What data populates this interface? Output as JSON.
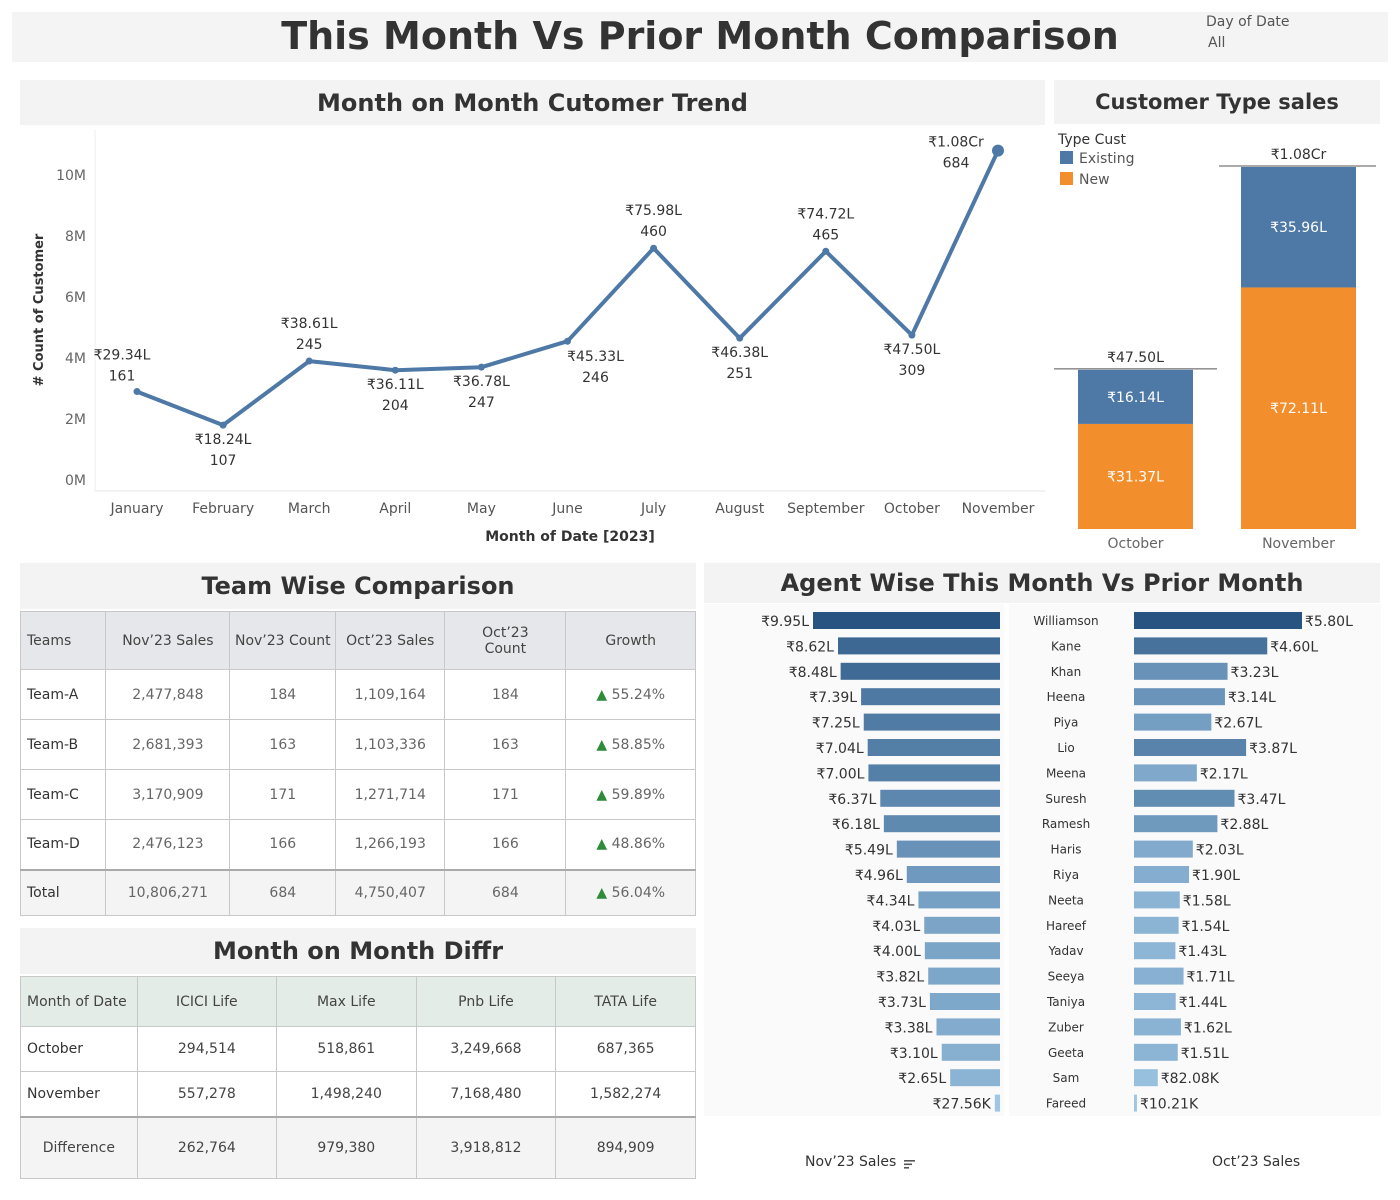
{
  "header": {
    "title": "This Month Vs Prior Month Comparison",
    "filter_label": "Day of Date",
    "filter_value": "All"
  },
  "colors": {
    "line": "#4e79a7",
    "existing": "#4e79a7",
    "new": "#f28e2b",
    "growth_up": "#2e8b3a"
  },
  "trend": {
    "title": "Month on Month Cutomer Trend"
  },
  "customer_type": {
    "title": "Customer Type sales",
    "legend_title": "Type Cust"
  },
  "team": {
    "title": "Team Wise  Comparison",
    "headers": [
      "Teams",
      "Nov’23  Sales",
      "Nov’23  Count",
      "Oct’23 Sales",
      "Oct’23 Count",
      "Growth"
    ],
    "rows": [
      {
        "team": "Team-A",
        "nov_sales": "2,477,848",
        "nov_count": "184",
        "oct_sales": "1,109,164",
        "oct_count": "184",
        "growth": "55.24%"
      },
      {
        "team": "Team-B",
        "nov_sales": "2,681,393",
        "nov_count": "163",
        "oct_sales": "1,103,336",
        "oct_count": "163",
        "growth": "58.85%"
      },
      {
        "team": "Team-C",
        "nov_sales": "3,170,909",
        "nov_count": "171",
        "oct_sales": "1,271,714",
        "oct_count": "171",
        "growth": "59.89%"
      },
      {
        "team": "Team-D",
        "nov_sales": "2,476,123",
        "nov_count": "166",
        "oct_sales": "1,266,193",
        "oct_count": "166",
        "growth": "48.86%"
      }
    ],
    "total": {
      "team": "Total",
      "nov_sales": "10,806,271",
      "nov_count": "684",
      "oct_sales": "4,750,407",
      "oct_count": "684",
      "growth": "56.04%"
    },
    "growth_icon": "▲"
  },
  "mom": {
    "title": "Month on Month Diffr",
    "headers": [
      "Month of Date",
      "ICICI Life",
      "Max Life",
      "Pnb Life",
      "TATA Life"
    ],
    "rows": [
      {
        "month": "October",
        "icici": "294,514",
        "max": "518,861",
        "pnb": "3,249,668",
        "tata": "687,365"
      },
      {
        "month": "November",
        "icici": "557,278",
        "max": "1,498,240",
        "pnb": "7,168,480",
        "tata": "1,582,274"
      }
    ],
    "diff": {
      "month": "Difference",
      "icici": "262,764",
      "max": "979,380",
      "pnb": "3,918,812",
      "tata": "894,909"
    }
  },
  "agent": {
    "title": "Agent Wise This Month Vs Prior Month",
    "nov_footer": "Nov’23 Sales",
    "oct_footer": "Oct’23 Sales"
  },
  "chart_data": [
    {
      "type": "line",
      "title": "Month on Month Cutomer Trend",
      "xlabel": "Month of Date [2023]",
      "ylabel": "# Count of Customer",
      "categories": [
        "January",
        "February",
        "March",
        "April",
        "May",
        "June",
        "July",
        "August",
        "September",
        "October",
        "November"
      ],
      "values": [
        2900000,
        1800000,
        3900000,
        3600000,
        3700000,
        4550000,
        7600000,
        4650000,
        7500000,
        4750000,
        10800000
      ],
      "sales_labels": [
        "₹29.34L",
        "₹18.24L",
        "₹38.61L",
        "₹36.11L",
        "₹36.78L",
        "₹45.33L",
        "₹75.98L",
        "₹46.38L",
        "₹74.72L",
        "₹47.50L",
        "₹1.08Cr"
      ],
      "count_labels": [
        "161",
        "107",
        "245",
        "204",
        "247",
        "246",
        "460",
        "251",
        "465",
        "309",
        "684"
      ],
      "yticks": [
        "0M",
        "2M",
        "4M",
        "6M",
        "8M",
        "10M"
      ],
      "ylim": [
        0,
        11000000
      ],
      "grid": false
    },
    {
      "type": "bar",
      "stacked": true,
      "title": "Customer Type sales",
      "legend_title": "Type Cust",
      "legend_placement": "top-left",
      "categories": [
        "October",
        "November"
      ],
      "series": [
        {
          "name": "Existing",
          "values": [
            16.14,
            35.96
          ],
          "labels": [
            "₹16.14L",
            "₹35.96L"
          ]
        },
        {
          "name": "New",
          "values": [
            31.37,
            72.11
          ],
          "labels": [
            "₹31.37L",
            "₹72.11L"
          ]
        }
      ],
      "totals": [
        "₹47.50L",
        "₹1.08Cr"
      ],
      "unit": "lakh"
    },
    {
      "type": "bar",
      "orientation": "horizontal",
      "title": "Agent Wise This Month Vs Prior Month",
      "agents": [
        "Williamson",
        "Kane",
        "Khan",
        "Heena",
        "Piya",
        "Lio",
        "Meena",
        "Suresh",
        "Ramesh",
        "Haris",
        "Riya",
        "Neeta",
        "Hareef",
        "Yadav",
        "Seeya",
        "Taniya",
        "Zuber",
        "Geeta",
        "Sam",
        "Fareed"
      ],
      "series": [
        {
          "name": "Nov’23 Sales",
          "values": [
            9.95,
            8.62,
            8.48,
            7.39,
            7.25,
            7.04,
            7.0,
            6.37,
            6.18,
            5.49,
            4.96,
            4.34,
            4.03,
            4.0,
            3.82,
            3.73,
            3.38,
            3.1,
            2.65,
            0.2756
          ],
          "labels": [
            "₹9.95L",
            "₹8.62L",
            "₹8.48L",
            "₹7.39L",
            "₹7.25L",
            "₹7.04L",
            "₹7.00L",
            "₹6.37L",
            "₹6.18L",
            "₹5.49L",
            "₹4.96L",
            "₹4.34L",
            "₹4.03L",
            "₹4.00L",
            "₹3.82L",
            "₹3.73L",
            "₹3.38L",
            "₹3.10L",
            "₹2.65L",
            "₹27.56K"
          ]
        },
        {
          "name": "Oct’23 Sales",
          "values": [
            5.8,
            4.6,
            3.23,
            3.14,
            2.67,
            3.87,
            2.17,
            3.47,
            2.88,
            2.03,
            1.9,
            1.58,
            1.54,
            1.43,
            1.71,
            1.44,
            1.62,
            1.51,
            0.8208,
            0.1021
          ],
          "labels": [
            "₹5.80L",
            "₹4.60L",
            "₹3.23L",
            "₹3.14L",
            "₹2.67L",
            "₹3.87L",
            "₹2.17L",
            "₹3.47L",
            "₹2.88L",
            "₹2.03L",
            "₹1.90L",
            "₹1.58L",
            "₹1.54L",
            "₹1.43L",
            "₹1.71L",
            "₹1.44L",
            "₹1.62L",
            "₹1.51L",
            "₹82.08K",
            "₹10.21K"
          ]
        }
      ],
      "unit": "lakh"
    }
  ]
}
